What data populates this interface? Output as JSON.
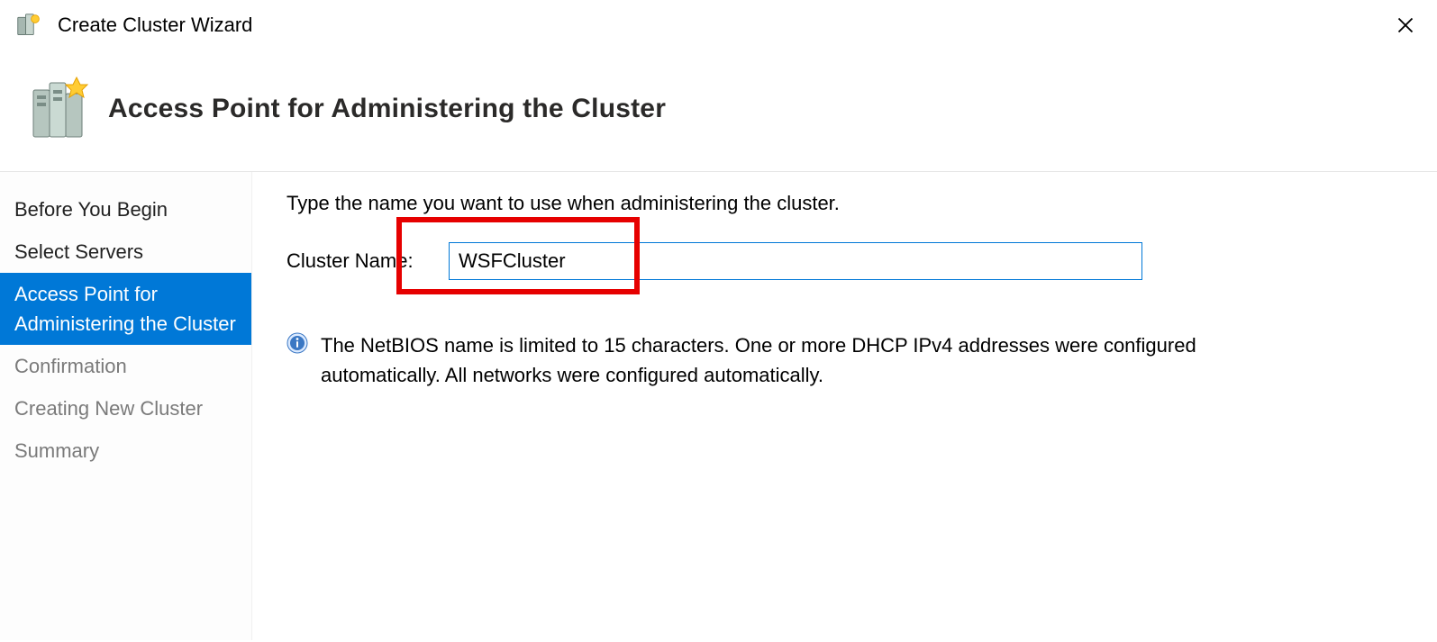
{
  "title": "Create Cluster Wizard",
  "page_title": "Access Point for Administering the Cluster",
  "sidebar": {
    "items": [
      {
        "label": "Before You Begin",
        "state": "done"
      },
      {
        "label": "Select Servers",
        "state": "done"
      },
      {
        "label": "Access Point for Administering the Cluster",
        "state": "active"
      },
      {
        "label": "Confirmation",
        "state": "pending"
      },
      {
        "label": "Creating New Cluster",
        "state": "pending"
      },
      {
        "label": "Summary",
        "state": "pending"
      }
    ]
  },
  "main": {
    "instruction": "Type the name you want to use when administering the cluster.",
    "cluster_name_label": "Cluster Name:",
    "cluster_name_value": "WSFCluster",
    "info_text": "The NetBIOS name is limited to 15 characters.  One or more DHCP IPv4 addresses were configured automatically.  All networks were configured automatically."
  }
}
